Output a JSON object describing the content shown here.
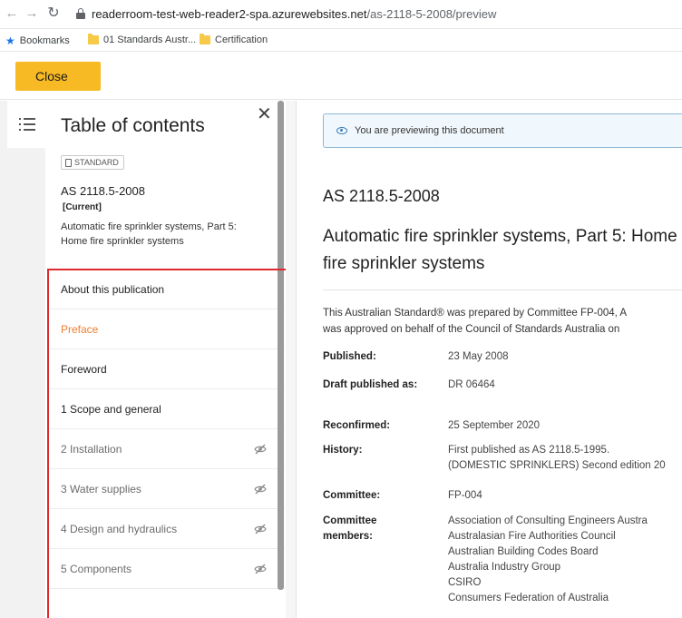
{
  "browser": {
    "url_host": "readerroom-test-web-reader2-spa.azurewebsites.net",
    "url_path": "/as-2118-5-2008/preview",
    "bookmarks": [
      {
        "label": "Bookmarks",
        "icon": "star-icon"
      },
      {
        "label": "01 Standards Austr...",
        "icon": "folder-icon"
      },
      {
        "label": "Certification",
        "icon": "folder-icon"
      }
    ]
  },
  "topbar": {
    "close_label": "Close",
    "accent": "#f7b924"
  },
  "toc": {
    "title": "Table of contents",
    "badge": "STANDARD",
    "doc_code": "AS 2118.5-2008",
    "doc_status": "[Current]",
    "doc_desc": "Automatic fire sprinkler systems, Part 5: Home fire sprinkler systems",
    "items": [
      {
        "label": "About this publication",
        "state": "normal"
      },
      {
        "label": "Preface",
        "state": "active"
      },
      {
        "label": "Foreword",
        "state": "normal"
      },
      {
        "label": "1 Scope and general",
        "state": "normal"
      },
      {
        "label": "2 Installation",
        "state": "locked"
      },
      {
        "label": "3 Water supplies",
        "state": "locked"
      },
      {
        "label": "4 Design and hydraulics",
        "state": "locked"
      },
      {
        "label": "5 Components",
        "state": "locked"
      }
    ],
    "active_color": "#ee7d2f",
    "highlight_color": "#e0292e"
  },
  "main": {
    "banner": "You are previewing this document",
    "code": "AS 2118.5-2008",
    "title": "Automatic fire sprinkler systems, Part 5: Home fire sprinkler systems",
    "intro_line1": "This Australian Standard® was prepared by Committee FP-004, A",
    "intro_line2": "was approved on behalf of the Council of Standards Australia on",
    "meta": {
      "published_label": "Published:",
      "published": "23 May 2008",
      "draft_label": "Draft published as:",
      "draft": "DR 06464",
      "reconfirmed_label": "Reconfirmed:",
      "reconfirmed": "25 September 2020",
      "history_label": "History:",
      "history_1": "First published as AS 2118.5-1995.",
      "history_2": "(DOMESTIC SPRINKLERS) Second edition 20",
      "committee_label": "Committee:",
      "committee": "FP-004",
      "members_label": "Committee members:",
      "members": [
        "Association of Consulting Engineers Austra",
        "Australasian Fire Authorities Council",
        "Australian Building Codes Board",
        "Australia Industry Group",
        "CSIRO",
        "Consumers Federation of Australia"
      ]
    }
  }
}
